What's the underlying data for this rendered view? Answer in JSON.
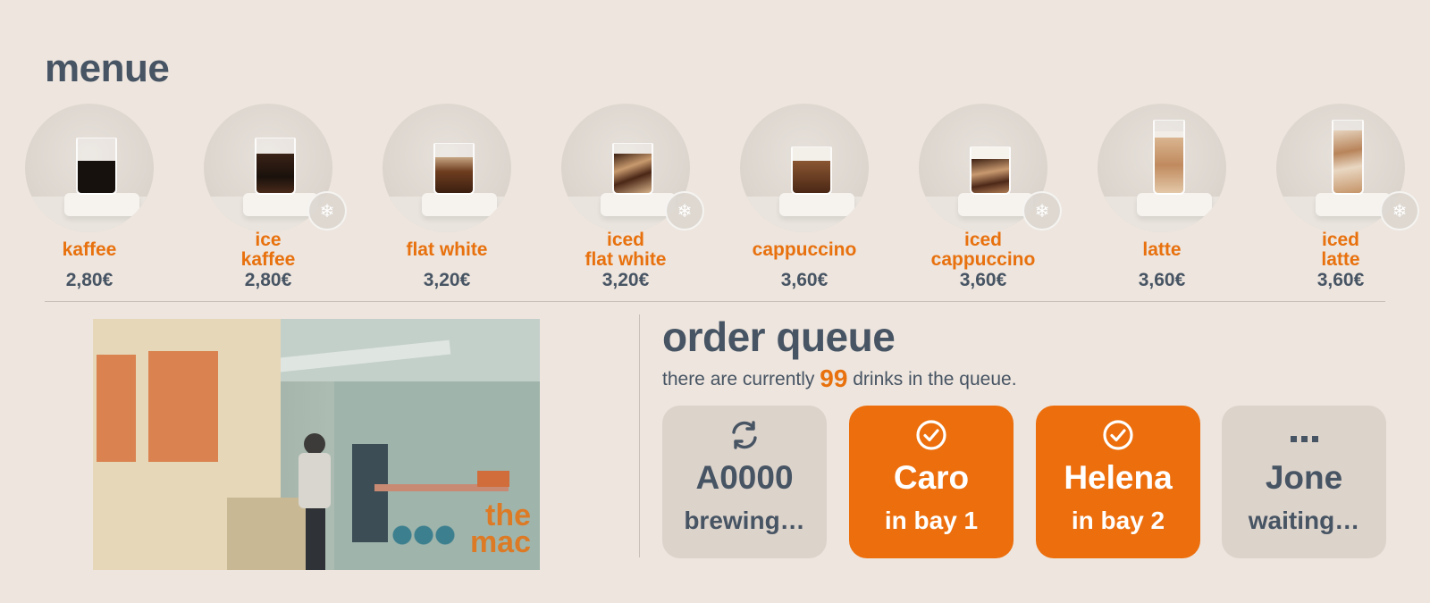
{
  "menu": {
    "title": "menue",
    "items": [
      {
        "name_lines": [
          "kaffee"
        ],
        "price": "2,80€",
        "iced": false
      },
      {
        "name_lines": [
          "ice",
          "kaffee"
        ],
        "price": "2,80€",
        "iced": true
      },
      {
        "name_lines": [
          "flat white"
        ],
        "price": "3,20€",
        "iced": false
      },
      {
        "name_lines": [
          "iced",
          "flat white"
        ],
        "price": "3,20€",
        "iced": true
      },
      {
        "name_lines": [
          "cappuccino"
        ],
        "price": "3,60€",
        "iced": false
      },
      {
        "name_lines": [
          "iced",
          "cappuccino"
        ],
        "price": "3,60€",
        "iced": true
      },
      {
        "name_lines": [
          "latte"
        ],
        "price": "3,60€",
        "iced": false
      },
      {
        "name_lines": [
          "iced",
          "latte"
        ],
        "price": "3,60€",
        "iced": true
      }
    ]
  },
  "video": {
    "logo_line1": "the",
    "logo_line2": "mac"
  },
  "queue": {
    "title": "order queue",
    "text_before": "there are currently ",
    "count": "99",
    "text_after": " drinks in the queue.",
    "orders": [
      {
        "name": "A0000",
        "status": "brewing…",
        "icon": "sync-icon",
        "style": "gray"
      },
      {
        "name": "Caro",
        "status": "in bay 1",
        "icon": "check-circle-icon",
        "style": "orange"
      },
      {
        "name": "Helena",
        "status": "in bay 2",
        "icon": "check-circle-icon",
        "style": "orange"
      },
      {
        "name": "Jone",
        "status": "waiting…",
        "icon": "ellipsis-icon",
        "style": "gray"
      }
    ]
  },
  "colors": {
    "background": "#ede5de",
    "accent": "#e8710e",
    "text": "#475463",
    "card_gray": "#dcd3cb",
    "card_orange": "#ec6e0c"
  }
}
